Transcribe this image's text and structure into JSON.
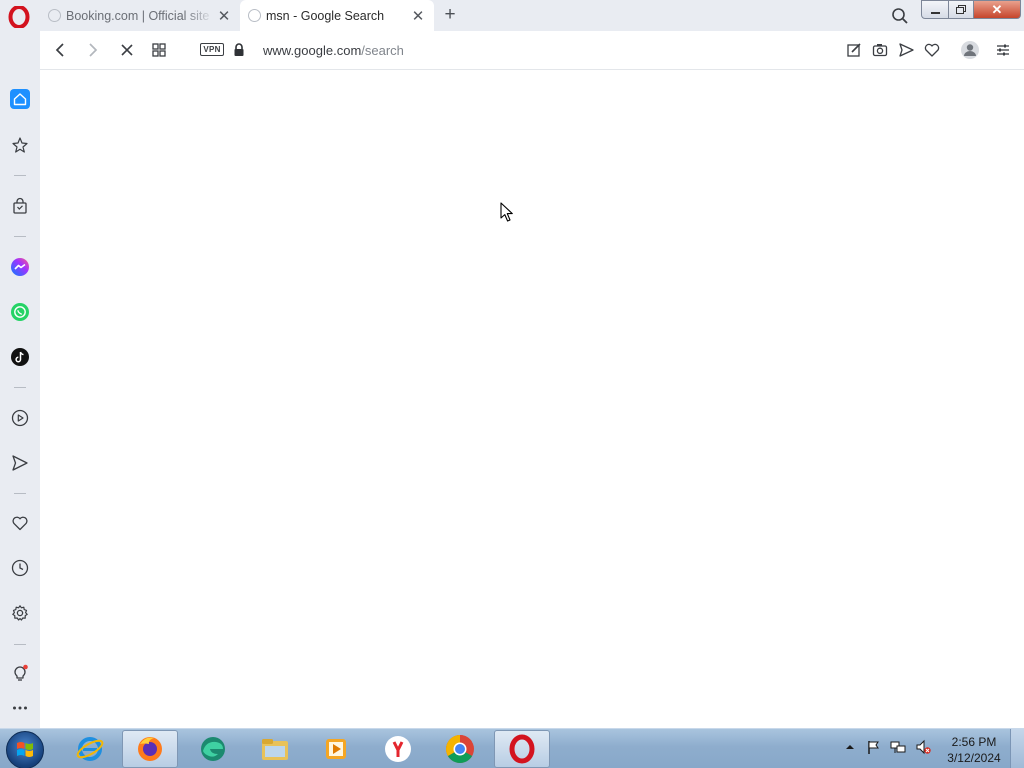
{
  "tabs": [
    {
      "title": "Booking.com | Official site",
      "state": "inactive"
    },
    {
      "title": "msn - Google Search",
      "state": "active"
    }
  ],
  "addressbar": {
    "vpn_label": "VPN",
    "url_domain": "www.google.com",
    "url_path": "/search"
  },
  "taskbar": {
    "time": "2:56 PM",
    "date": "3/12/2024",
    "apps": [
      "internet-explorer",
      "firefox",
      "edge",
      "file-explorer",
      "media-player",
      "yandex",
      "chrome",
      "opera"
    ]
  },
  "colors": {
    "accent": "#1e90ff",
    "opera_red": "#d3131f",
    "sidebar_bg": "#e9ecf2",
    "taskbar_bg": "#8eadcd"
  }
}
